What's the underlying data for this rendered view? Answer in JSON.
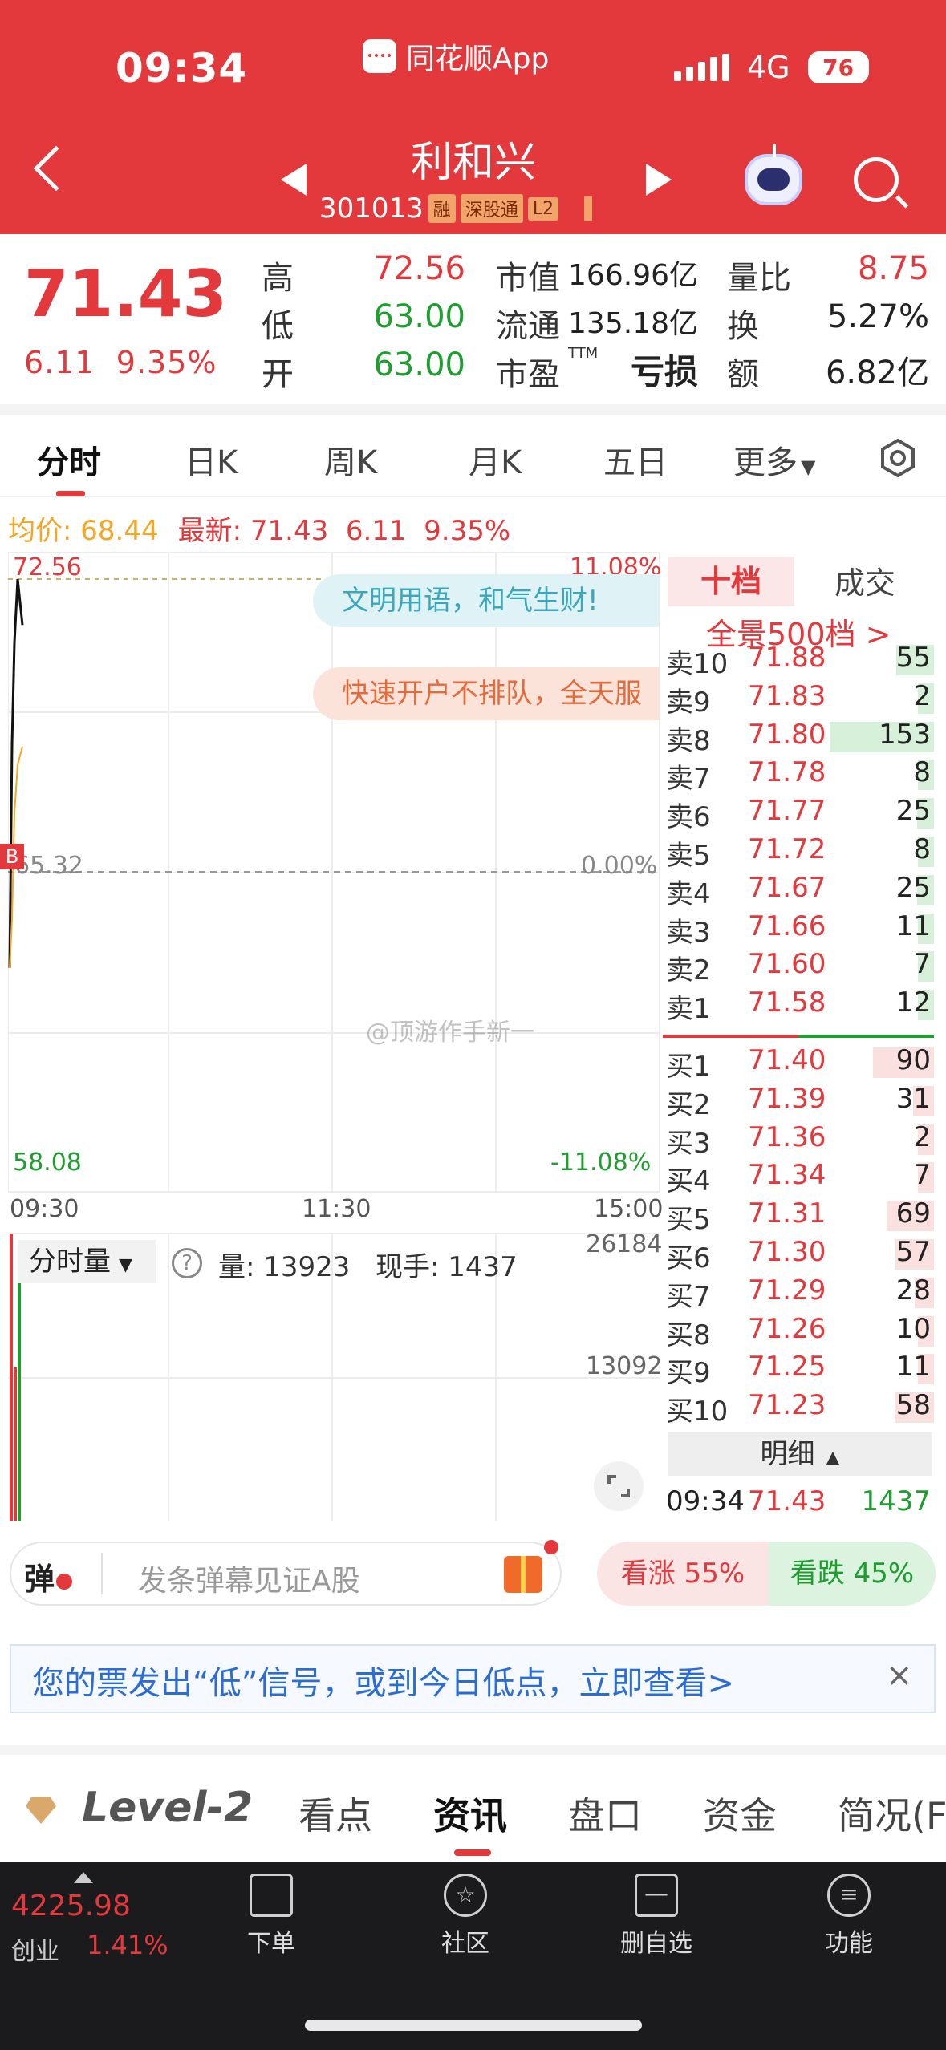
{
  "status_bar": {
    "time": "09:34",
    "app_name": "同花顺App",
    "network": "4G",
    "battery": "76"
  },
  "header": {
    "stock_name": "利和兴",
    "stock_code": "301013",
    "tags": [
      "融",
      "深股通",
      "L2"
    ]
  },
  "quote": {
    "price": "71.43",
    "change": "6.11",
    "change_pct": "9.35%",
    "fields": [
      {
        "label": "高",
        "value": "72.56"
      },
      {
        "label": "低",
        "value": "63.00"
      },
      {
        "label": "开",
        "value": "63.00"
      },
      {
        "label": "市值",
        "value": "166.96亿"
      },
      {
        "label": "流通",
        "value": "135.18亿"
      },
      {
        "label": "市盈",
        "sup": "TTM",
        "value": "亏损"
      },
      {
        "label": "量比",
        "value": "8.75"
      },
      {
        "label": "换",
        "value": "5.27%"
      },
      {
        "label": "额",
        "value": "6.82亿"
      }
    ]
  },
  "chart_tabs": [
    "分时",
    "日K",
    "周K",
    "月K",
    "五日",
    "更多"
  ],
  "avg_line": {
    "avg_label": "均价: 68.44",
    "latest_label": "最新: 71.43",
    "chg": "6.11",
    "pct": "9.35%"
  },
  "chart_data": {
    "type": "line",
    "title": "",
    "price_ticks": {
      "high": "72.56",
      "mid": "65.32",
      "low": "58.08"
    },
    "pct_ticks": {
      "high": "11.08%",
      "mid": "0.00%",
      "low": "-11.08%"
    },
    "time_ticks": [
      "09:30",
      "11:30",
      "15:00"
    ],
    "ylim": [
      58.08,
      72.56
    ],
    "series": [
      {
        "values": [
          63.0,
          68.5,
          71.0,
          72.56,
          71.43
        ],
        "color": "#111111"
      },
      {
        "values": [
          63.0,
          64.2,
          66.8,
          68.0,
          68.44
        ],
        "color": "#f5a623"
      }
    ],
    "volume": {
      "label": "分时量",
      "vol_label": "量: 13923",
      "hand_label": "现手: 1437",
      "ticks": [
        "26184",
        "13092"
      ],
      "ylim": [
        0,
        26184
      ],
      "values": [
        26184,
        14000,
        22000
      ]
    }
  },
  "banners": [
    "文明用语，和气生财!",
    "快速开户不排队，全天服"
  ],
  "order_book": {
    "tab_active": "十档",
    "tab_other": "成交",
    "panorama": "全景500档 >",
    "asks": [
      {
        "level": "卖10",
        "price": "71.88",
        "qty": "55"
      },
      {
        "level": "卖9",
        "price": "71.83",
        "qty": "2"
      },
      {
        "level": "卖8",
        "price": "71.80",
        "qty": "153"
      },
      {
        "level": "卖7",
        "price": "71.78",
        "qty": "8"
      },
      {
        "level": "卖6",
        "price": "71.77",
        "qty": "25"
      },
      {
        "level": "卖5",
        "price": "71.72",
        "qty": "8"
      },
      {
        "level": "卖4",
        "price": "71.67",
        "qty": "25"
      },
      {
        "level": "卖3",
        "price": "71.66",
        "qty": "11"
      },
      {
        "level": "卖2",
        "price": "71.60",
        "qty": "7"
      },
      {
        "level": "卖1",
        "price": "71.58",
        "qty": "12"
      }
    ],
    "bids": [
      {
        "level": "买1",
        "price": "71.40",
        "qty": "90"
      },
      {
        "level": "买2",
        "price": "71.39",
        "qty": "31"
      },
      {
        "level": "买3",
        "price": "71.36",
        "qty": "2"
      },
      {
        "level": "买4",
        "price": "71.34",
        "qty": "7"
      },
      {
        "level": "买5",
        "price": "71.31",
        "qty": "69"
      },
      {
        "level": "买6",
        "price": "71.30",
        "qty": "57"
      },
      {
        "level": "买7",
        "price": "71.29",
        "qty": "28"
      },
      {
        "level": "买8",
        "price": "71.26",
        "qty": "10"
      },
      {
        "level": "买9",
        "price": "71.25",
        "qty": "11"
      },
      {
        "level": "买10",
        "price": "71.23",
        "qty": "58"
      }
    ],
    "detail_label": "明细",
    "last_trade": {
      "time": "09:34",
      "price": "71.43",
      "qty": "1437"
    }
  },
  "danmu": {
    "icon": "弹",
    "placeholder": "发条弹幕见证A股"
  },
  "vote": {
    "up": "看涨 55%",
    "down": "看跌 45%",
    "up_share": 0.55
  },
  "notice": {
    "text": "您的票发出“低”信号，或到今日低点，立即查看>",
    "close": "×"
  },
  "info_tabs": [
    "Level-2",
    "看点",
    "资讯",
    "盘口",
    "资金",
    "简况(F"
  ],
  "bottom_nav": {
    "index_value": "4225.98",
    "index_name": "创业",
    "index_pct": "1.41%",
    "items": [
      "下单",
      "社区",
      "删自选",
      "功能"
    ]
  },
  "watermark": "@顶游作手新一",
  "colors": {
    "up": "#e4393c",
    "down": "#1e9e2e",
    "header": "#e4393c"
  }
}
